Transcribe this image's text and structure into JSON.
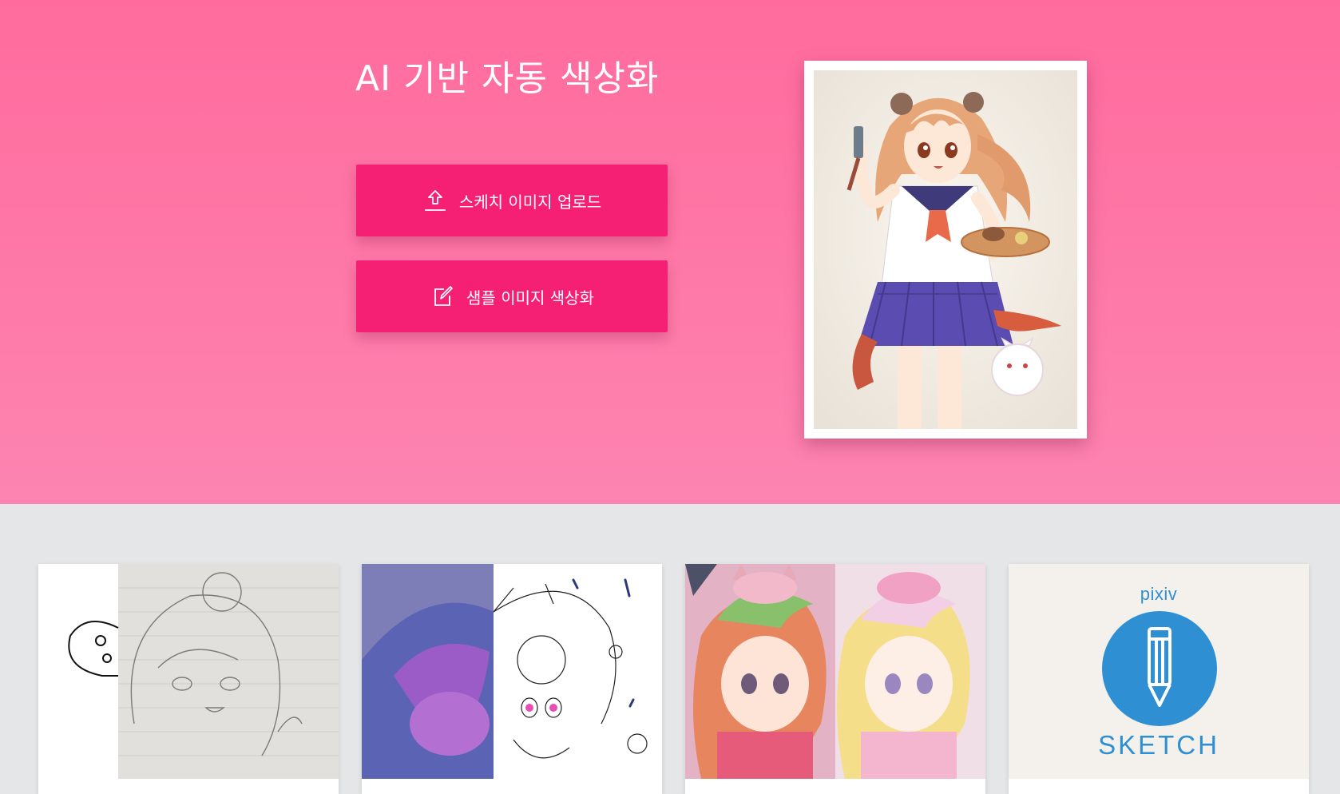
{
  "hero": {
    "title": "AI 기반 자동 색상화",
    "upload_button": {
      "label": "스케치 이미지 업로드",
      "icon": "upload-icon"
    },
    "sample_button": {
      "label": "샘플 이미지 색상화",
      "icon": "edit-icon"
    },
    "showcase_image": "colorized-anime-girl-illustration"
  },
  "gallery": {
    "cards": [
      {
        "image": "pencil-sketch-girl-with-bear-hood"
      },
      {
        "image": "umbrella-girl-with-cats-lineart-and-color"
      },
      {
        "image": "cat-ear-girls-color-comparison"
      },
      {
        "image": "pixiv-sketch-logo",
        "logo_top": "pixiv",
        "logo_bottom": "SKETCH"
      }
    ]
  },
  "colors": {
    "hero_top": "#ff6b9d",
    "hero_bottom": "#fd84b0",
    "button": "#f51f74",
    "gallery_bg": "#e4e6e8",
    "pixiv_blue": "#2f8fd3"
  }
}
